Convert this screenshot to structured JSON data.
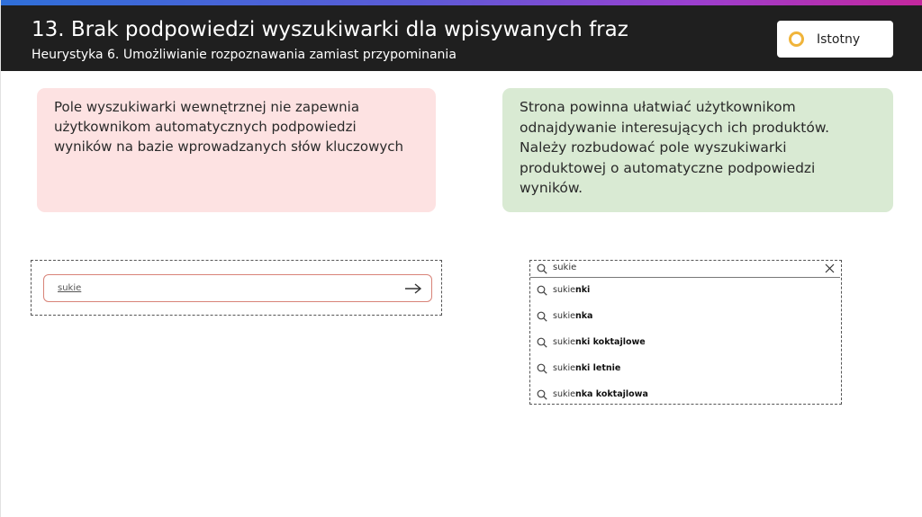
{
  "header": {
    "title": "13. Brak podpowiedzi wyszukiwarki dla wpisywanych fraz",
    "subtitle": "Heurystyka 6. Umożliwianie rozpoznawania zamiast przypominania",
    "badge": {
      "label": "Istotny",
      "icon": "ring-icon",
      "icon_color": "#f0b43a"
    }
  },
  "problem": {
    "text": "Pole wyszukiwarki wewnętrznej nie zapewnia użytkownikom automatycznych podpowiedzi wyników na bazie wprowadzanych słów kluczowych",
    "background": "#fde2e2"
  },
  "solution": {
    "text": "Strona powinna ułatwiać użytkownikom odnajdywanie interesujących ich produktów. Należy rozbudować pole wyszukiwarki produktowej o automatyczne podpowiedzi wyników.",
    "background": "#d9ead3"
  },
  "bad_example": {
    "query": "sukie",
    "submit_icon": "arrow-right-icon"
  },
  "good_example": {
    "query": "sukie",
    "suggestions": [
      {
        "prefix": "sukie",
        "rest": "nki"
      },
      {
        "prefix": "sukie",
        "rest": "nka"
      },
      {
        "prefix": "sukie",
        "rest": "nki koktajlowe"
      },
      {
        "prefix": "sukie",
        "rest": "nki letnie"
      },
      {
        "prefix": "sukie",
        "rest": "nka koktajlowa"
      }
    ]
  },
  "colors": {
    "header_bg": "#1f1f1f",
    "input_border": "#d88378"
  }
}
